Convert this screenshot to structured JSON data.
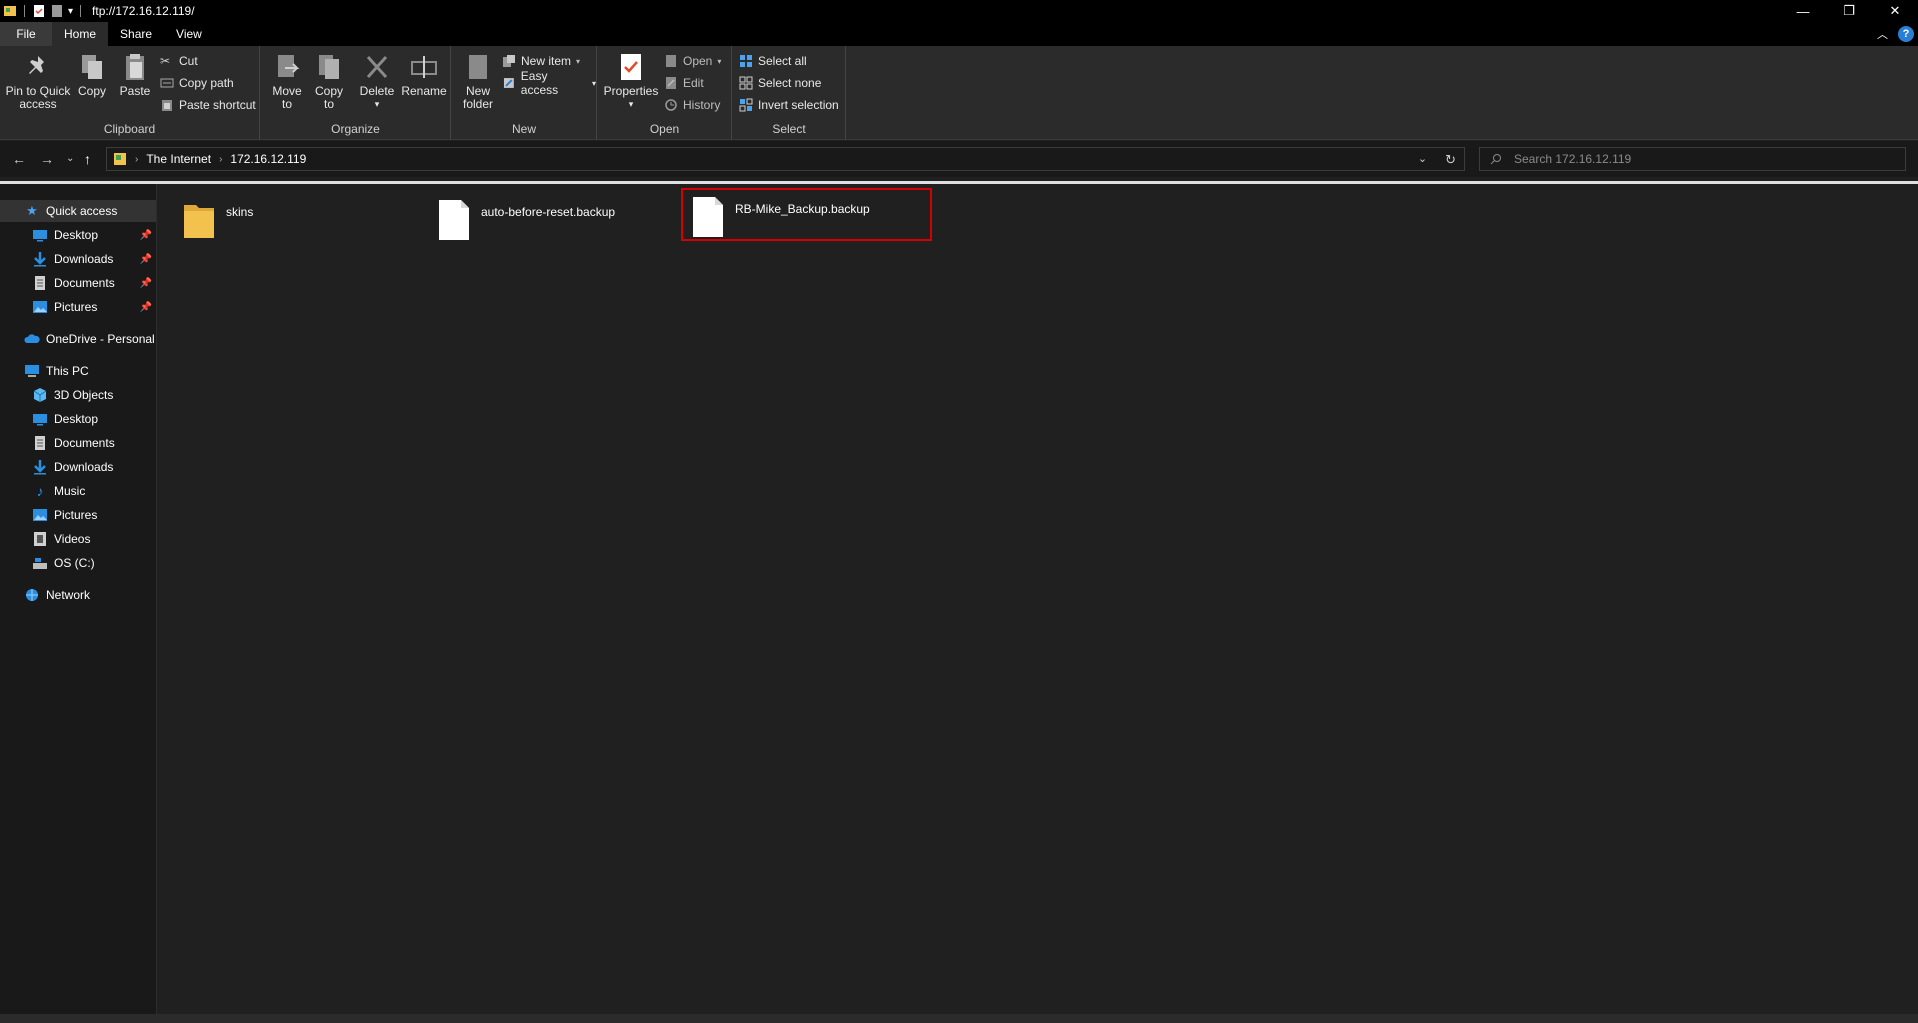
{
  "window": {
    "title": "ftp://172.16.12.119/"
  },
  "window_controls": {
    "minimize": "—",
    "restore": "❐",
    "close": "✕"
  },
  "tabs": [
    {
      "label": "File"
    },
    {
      "label": "Home"
    },
    {
      "label": "Share"
    },
    {
      "label": "View"
    }
  ],
  "ribbon": {
    "clipboard": {
      "label": "Clipboard",
      "pin": "Pin to Quick access",
      "pin_line1": "Pin to Quick",
      "pin_line2": "access",
      "copy": "Copy",
      "paste": "Paste",
      "cut": "Cut",
      "copy_path": "Copy path",
      "paste_shortcut": "Paste shortcut"
    },
    "organize": {
      "label": "Organize",
      "move_line1": "Move",
      "move_line2": "to",
      "copy_line1": "Copy",
      "copy_line2": "to",
      "delete": "Delete",
      "rename": "Rename"
    },
    "new": {
      "label": "New",
      "folder_line1": "New",
      "folder_line2": "folder",
      "new_item": "New item",
      "easy_access": "Easy access"
    },
    "open": {
      "label": "Open",
      "properties": "Properties",
      "open": "Open",
      "edit": "Edit",
      "history": "History"
    },
    "select": {
      "label": "Select",
      "select_all": "Select all",
      "select_none": "Select none",
      "invert": "Invert selection"
    }
  },
  "address": {
    "crumbs": [
      "The Internet",
      "172.16.12.119"
    ],
    "search_placeholder": "Search 172.16.12.119"
  },
  "sidebar": {
    "quick_access": "Quick access",
    "quick_items": [
      "Desktop",
      "Downloads",
      "Documents",
      "Pictures"
    ],
    "onedrive": "OneDrive - Personal",
    "this_pc": "This PC",
    "pc_items": [
      "3D Objects",
      "Desktop",
      "Documents",
      "Downloads",
      "Music",
      "Pictures",
      "Videos",
      "OS (C:)"
    ],
    "network": "Network"
  },
  "files": [
    {
      "name": "skins",
      "type": "folder"
    },
    {
      "name": "auto-before-reset.backup",
      "type": "file"
    },
    {
      "name": "RB-Mike_Backup.backup",
      "type": "file"
    }
  ],
  "colors": {
    "accent": "#2a7fd4",
    "highlight": "#d40000",
    "folder": "#f2c14e"
  }
}
